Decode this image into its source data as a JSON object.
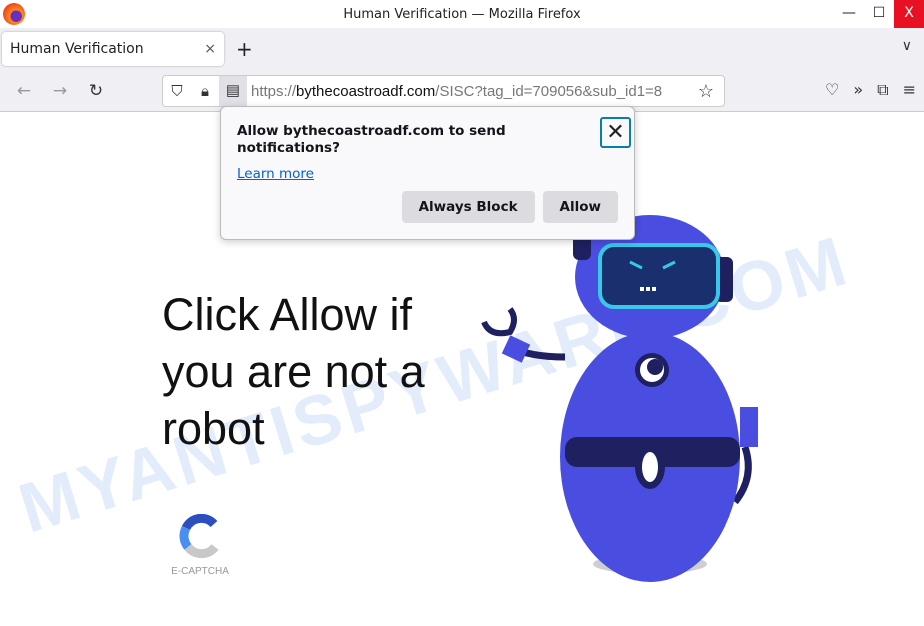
{
  "window": {
    "title": "Human Verification — Mozilla Firefox",
    "minimize": "—",
    "maximize": "☐",
    "close": "X"
  },
  "tab": {
    "label": "Human Verification",
    "close": "×",
    "new_tab": "+",
    "list": "∨"
  },
  "nav": {
    "back": "←",
    "forward": "→",
    "reload": "↻"
  },
  "url": {
    "scheme": "https://",
    "host": "bythecoastroadf.com",
    "path": "/SISC?tag_id=709056&sub_id1=8"
  },
  "toolbar": {
    "star": "☆",
    "pocket": "♡",
    "overflow": "»",
    "extensions": "⧉",
    "menu": "≡"
  },
  "popup": {
    "message": "Allow bythecoastroadf.com to send notifications?",
    "learn_more": "Learn more",
    "close": "✕",
    "block": "Always Block",
    "allow": "Allow"
  },
  "page": {
    "headline": "Click Allow if you are not a robot",
    "captcha_label": "E-CAPTCHA",
    "watermark": "MYANTISPYWARE.COM"
  },
  "colors": {
    "robot": "#4a4ee0",
    "visor": "#1a2f6e",
    "visor_rim": "#38c8e8",
    "close_hover": "#e81123"
  }
}
